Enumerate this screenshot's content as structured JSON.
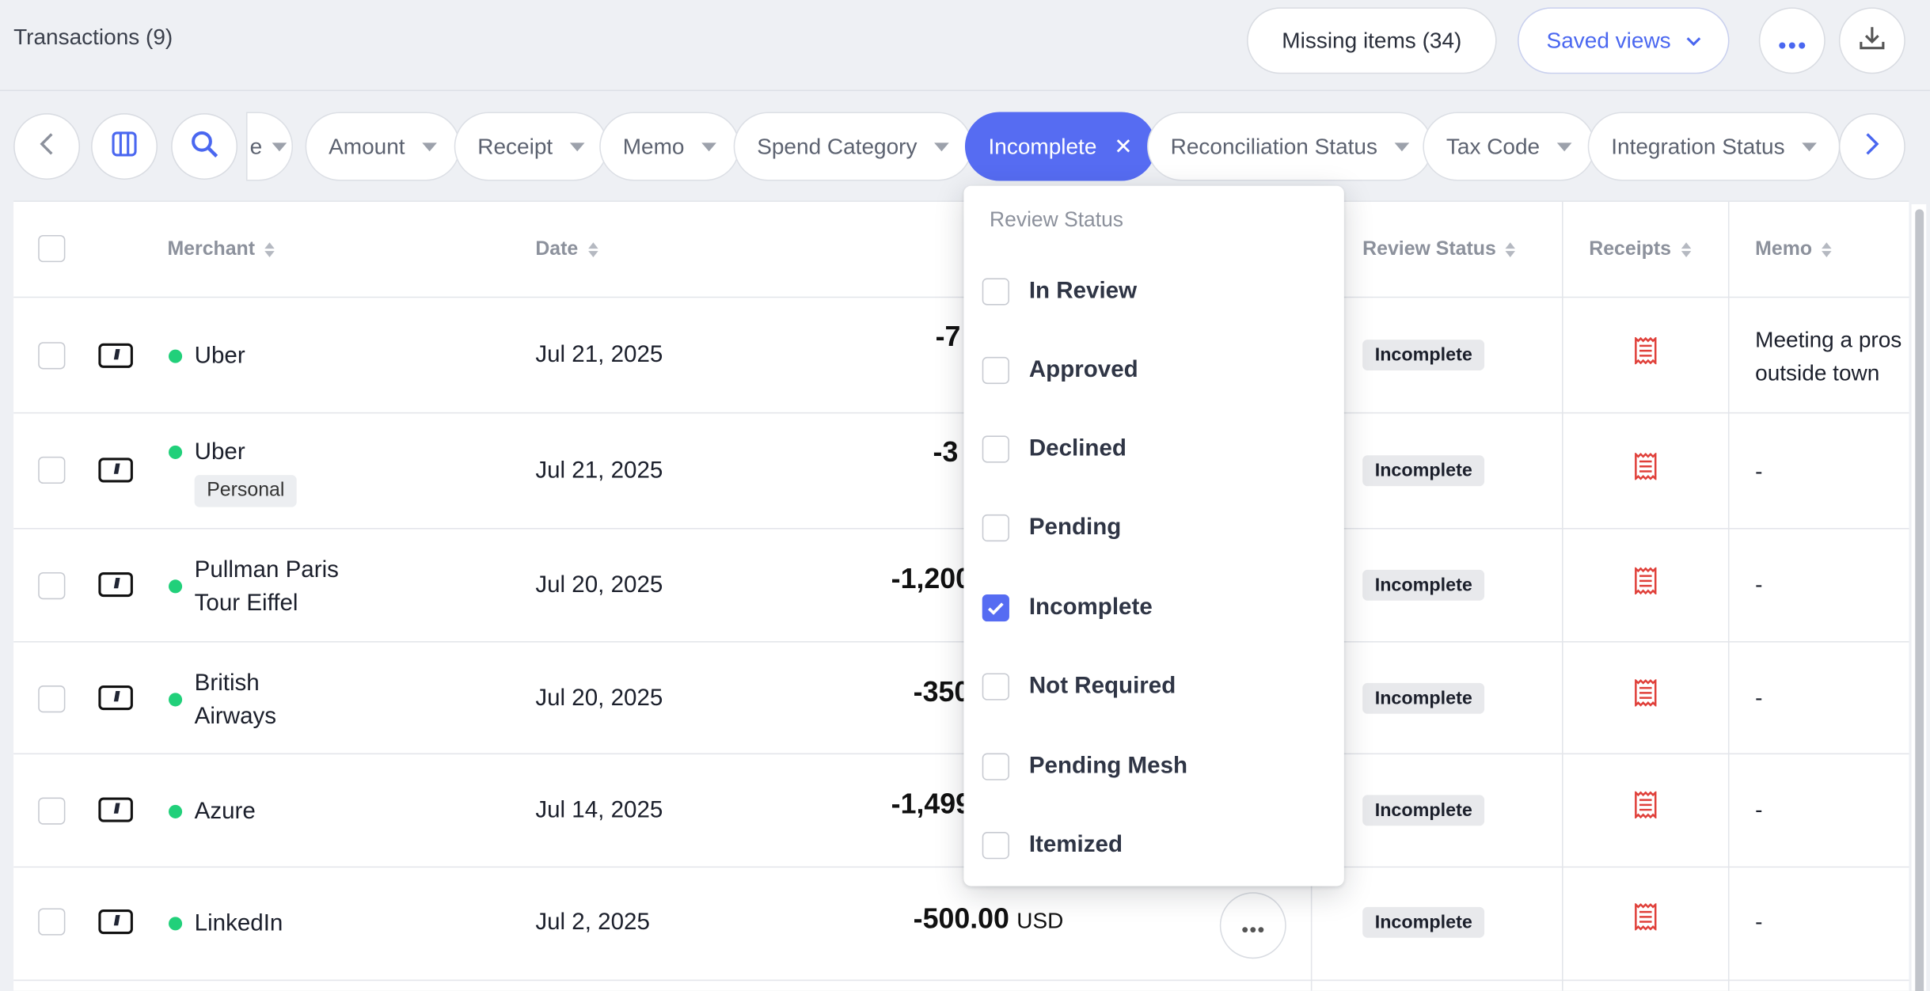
{
  "header": {
    "title": "Transactions (9)",
    "missing_items_label": "Missing items (34)",
    "saved_views_label": "Saved views"
  },
  "filters": {
    "truncated_label": "e",
    "chips": [
      "Amount",
      "Receipt",
      "Memo",
      "Spend Category"
    ],
    "active_chip": "Incomplete",
    "chips_after": [
      "Reconciliation Status",
      "Tax Code",
      "Integration Status"
    ]
  },
  "table": {
    "columns": {
      "merchant": "Merchant",
      "date": "Date",
      "review_status": "Review Status",
      "receipts": "Receipts",
      "memo": "Memo"
    },
    "rows": [
      {
        "merchant_line1": "Uber",
        "merchant_line2": "",
        "tag": "",
        "date": "Jul 21, 2025",
        "amount": "-7",
        "currency": "",
        "status": "Incomplete",
        "memo_line1": "Meeting a pros",
        "memo_line2": "outside town"
      },
      {
        "merchant_line1": "Uber",
        "merchant_line2": "",
        "tag": "Personal",
        "date": "Jul 21, 2025",
        "amount": "-3",
        "currency": "",
        "status": "Incomplete",
        "memo_line1": "-",
        "memo_line2": ""
      },
      {
        "merchant_line1": "Pullman Paris",
        "merchant_line2": "Tour Eiffel",
        "tag": "",
        "date": "Jul 20, 2025",
        "amount": "-1,200",
        "currency": "",
        "status": "Incomplete",
        "memo_line1": "-",
        "memo_line2": ""
      },
      {
        "merchant_line1": "British",
        "merchant_line2": "Airways",
        "tag": "",
        "date": "Jul 20, 2025",
        "amount": "-350",
        "currency": "",
        "status": "Incomplete",
        "memo_line1": "-",
        "memo_line2": ""
      },
      {
        "merchant_line1": "Azure",
        "merchant_line2": "",
        "tag": "",
        "date": "Jul 14, 2025",
        "amount": "-1,499",
        "currency": "",
        "status": "Incomplete",
        "memo_line1": "-",
        "memo_line2": ""
      },
      {
        "merchant_line1": "LinkedIn",
        "merchant_line2": "",
        "tag": "",
        "date": "Jul 2, 2025",
        "amount": "-500.00",
        "currency": "USD",
        "status": "Incomplete",
        "memo_line1": "-",
        "memo_line2": ""
      }
    ]
  },
  "dropdown": {
    "title": "Review Status",
    "options": [
      {
        "label": "In Review",
        "checked": false
      },
      {
        "label": "Approved",
        "checked": false
      },
      {
        "label": "Declined",
        "checked": false
      },
      {
        "label": "Pending",
        "checked": false
      },
      {
        "label": "Incomplete",
        "checked": true
      },
      {
        "label": "Not Required",
        "checked": false
      },
      {
        "label": "Pending Mesh",
        "checked": false
      },
      {
        "label": "Itemized",
        "checked": false
      }
    ]
  },
  "icons": {
    "more": "more-horizontal-icon",
    "download": "download-icon",
    "chevron_left": "chevron-left-icon",
    "chevron_right": "chevron-right-icon",
    "columns": "columns-icon",
    "search": "search-icon",
    "card": "card-icon",
    "receipt": "receipt-icon",
    "check": "check-icon"
  },
  "colors": {
    "accent": "#566cf2",
    "status_dot": "#21d07a",
    "receipt_missing": "#e0403a"
  }
}
